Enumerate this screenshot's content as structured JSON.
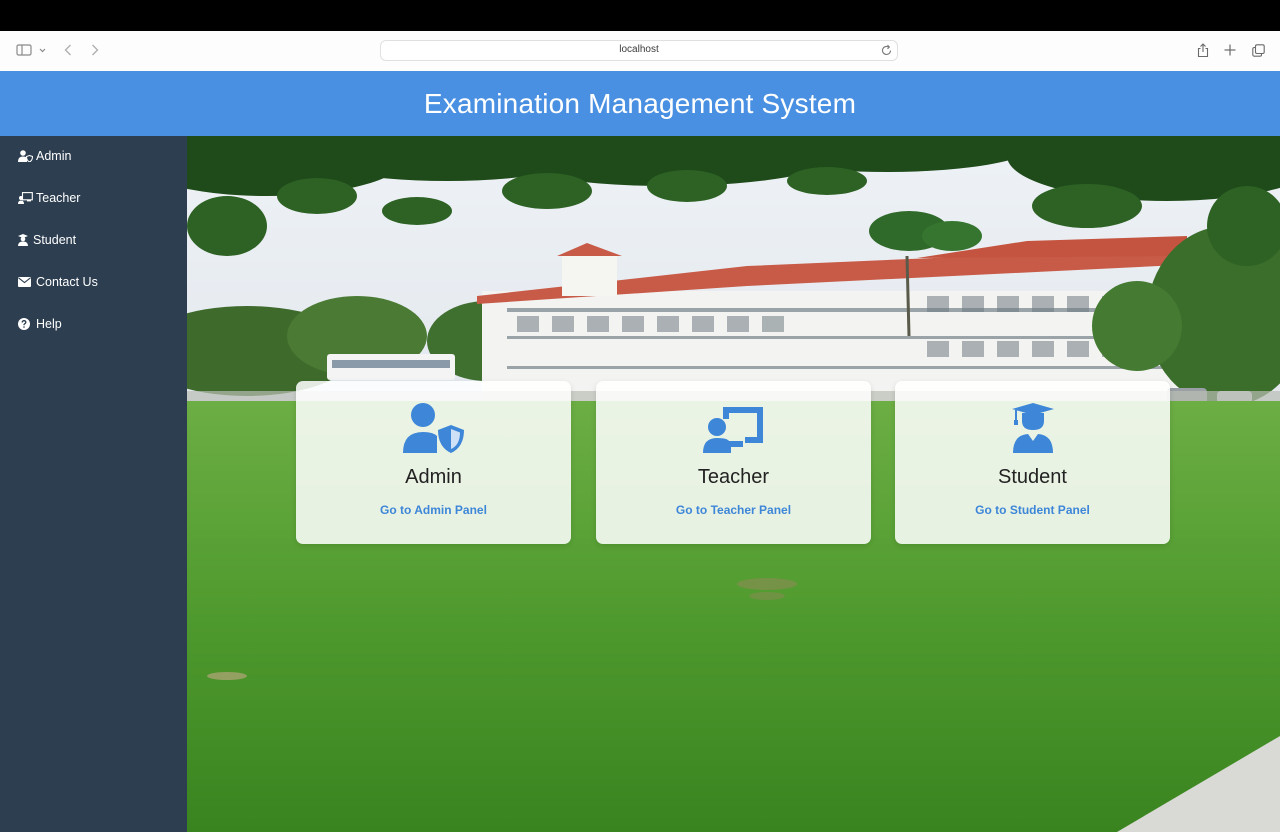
{
  "browser": {
    "url": "localhost"
  },
  "header": {
    "title": "Examination Management System"
  },
  "sidebar": {
    "items": [
      {
        "label": "Admin",
        "icon": "user-shield-icon"
      },
      {
        "label": "Teacher",
        "icon": "chalkboard-teacher-icon"
      },
      {
        "label": "Student",
        "icon": "user-graduate-icon"
      },
      {
        "label": "Contact Us",
        "icon": "envelope-icon"
      },
      {
        "label": "Help",
        "icon": "question-circle-icon"
      }
    ]
  },
  "cards": [
    {
      "title": "Admin",
      "link": "Go to Admin Panel",
      "icon": "user-shield-icon"
    },
    {
      "title": "Teacher",
      "link": "Go to Teacher Panel",
      "icon": "chalkboard-teacher-icon"
    },
    {
      "title": "Student",
      "link": "Go to Student Panel",
      "icon": "user-graduate-icon"
    }
  ],
  "colors": {
    "header": "#4a90e2",
    "sidebar": "#2d3e50",
    "accent": "#3d86d8"
  }
}
